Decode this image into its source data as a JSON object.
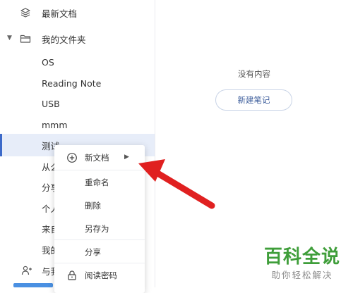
{
  "sidebar": {
    "recent_label": "最新文档",
    "my_folder_label": "我的文件夹",
    "folders": [
      "OS",
      "Reading Note",
      "USB",
      "mmm",
      "测试",
      "从么",
      "分享",
      "个人",
      "来自",
      "我的"
    ],
    "share_label": "与我"
  },
  "main": {
    "empty_text": "没有内容",
    "new_note_button": "新建笔记"
  },
  "context_menu": {
    "items": [
      "新文档",
      "重命名",
      "删除",
      "另存为",
      "分享",
      "阅读密码"
    ]
  },
  "watermark": {
    "title": "百科全说",
    "subtitle": "助你轻松解决"
  },
  "colors": {
    "accent": "#3d6ac9",
    "selected_bg": "#e7edf9",
    "arrow": "#e02020",
    "watermark_green": "#3f9e3a"
  }
}
